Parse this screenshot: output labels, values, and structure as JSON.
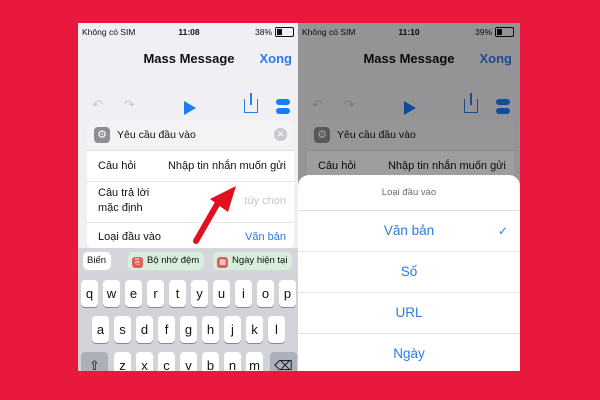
{
  "colors": {
    "background": "#e8193c",
    "accent": "#2c7be5",
    "run": "#1a7cf5"
  },
  "left": {
    "status": {
      "carrier": "Không có SIM",
      "time": "11:08",
      "battery": "38%",
      "battery_level": 0.38
    },
    "nav": {
      "title": "Mass Message",
      "done": "Xong"
    },
    "toolbar_icons": [
      "undo-icon",
      "redo-icon",
      "play-icon",
      "share-icon",
      "settings-toggle-icon"
    ],
    "card": {
      "title": "Yêu cầu đầu vào",
      "prompt_label": "Câu hỏi",
      "prompt_value": "Nhập tin nhắn muốn gửi",
      "default_label_1": "Câu trả lời",
      "default_label_2": "mặc định",
      "default_placeholder": "tùy chọn",
      "type_label": "Loại đầu vào",
      "type_value": "Văn bản"
    },
    "variables": {
      "label": "Biến",
      "clipboard": "Bộ nhớ đệm",
      "current_date": "Ngày hiện tại"
    },
    "keyboard": {
      "row1": [
        "q",
        "w",
        "e",
        "r",
        "t",
        "y",
        "u",
        "i",
        "o",
        "p"
      ],
      "row2": [
        "a",
        "s",
        "d",
        "f",
        "g",
        "h",
        "j",
        "k",
        "l"
      ],
      "row3": [
        "z",
        "x",
        "c",
        "v",
        "b",
        "n",
        "m"
      ]
    }
  },
  "right": {
    "status": {
      "carrier": "Không có SIM",
      "time": "11:10",
      "battery": "39%",
      "battery_level": 0.39
    },
    "nav": {
      "title": "Mass Message",
      "done": "Xong"
    },
    "card": {
      "title": "Yêu cầu đầu vào",
      "prompt_label": "Câu hỏi",
      "prompt_value": "Nhập tin nhắn muốn gửi"
    },
    "sheet": {
      "title": "Loại đầu vào",
      "options": [
        "Văn bản",
        "Số",
        "URL",
        "Ngày"
      ],
      "selected": "Văn bản"
    }
  }
}
